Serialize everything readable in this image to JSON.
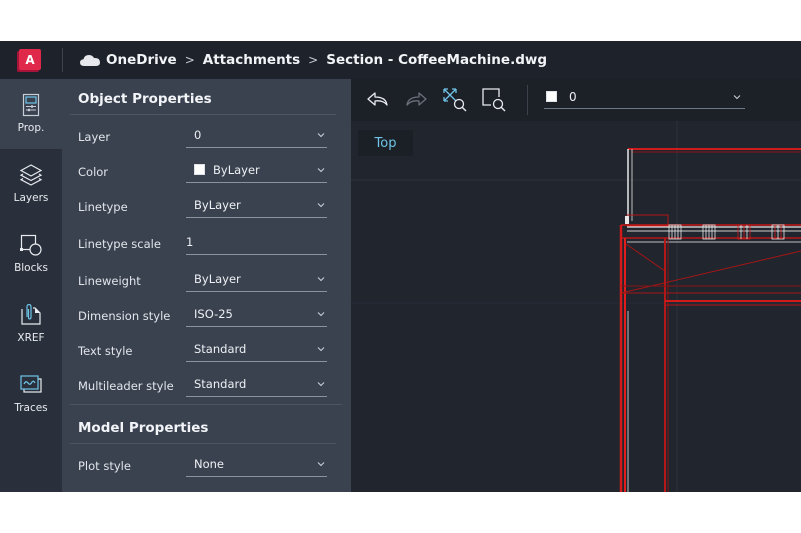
{
  "header": {
    "app_logo_letter": "A",
    "breadcrumb": [
      "OneDrive",
      "Attachments",
      "Section - CoffeeMachine.dwg"
    ],
    "separator": ">"
  },
  "rail": {
    "items": [
      {
        "label": "Prop.",
        "icon": "properties-icon",
        "active": true
      },
      {
        "label": "Layers",
        "icon": "layers-icon",
        "active": false
      },
      {
        "label": "Blocks",
        "icon": "blocks-icon",
        "active": false
      },
      {
        "label": "XREF",
        "icon": "xref-icon",
        "active": false
      },
      {
        "label": "Traces",
        "icon": "traces-icon",
        "active": false
      }
    ]
  },
  "panel": {
    "object_properties_title": "Object Properties",
    "object_properties": [
      {
        "label": "Layer",
        "value": "0",
        "type": "dropdown"
      },
      {
        "label": "Color",
        "value": "ByLayer",
        "type": "dropdown",
        "swatch": "#ffffff"
      },
      {
        "label": "Linetype",
        "value": "ByLayer",
        "type": "dropdown"
      },
      {
        "label": "Linetype scale",
        "value": "1",
        "type": "input"
      },
      {
        "label": "Lineweight",
        "value": "ByLayer",
        "type": "dropdown"
      },
      {
        "label": "Dimension style",
        "value": "ISO-25",
        "type": "dropdown"
      },
      {
        "label": "Text style",
        "value": "Standard",
        "type": "dropdown"
      },
      {
        "label": "Multileader style",
        "value": "Standard",
        "type": "dropdown"
      }
    ],
    "model_properties_title": "Model Properties",
    "model_properties": [
      {
        "label": "Plot style",
        "value": "None",
        "type": "dropdown"
      }
    ]
  },
  "toolbar": {
    "tools": [
      "undo-icon",
      "redo-icon",
      "zoom-extents-icon",
      "zoom-window-icon"
    ],
    "layer_value": "0",
    "layer_swatch": "#ffffff"
  },
  "canvas": {
    "view_label": "Top"
  },
  "colors": {
    "accent": "#6fc4e8",
    "brand": "#e0284b",
    "drawing_red": "#d11a1a",
    "drawing_white": "#e8e8e8"
  }
}
